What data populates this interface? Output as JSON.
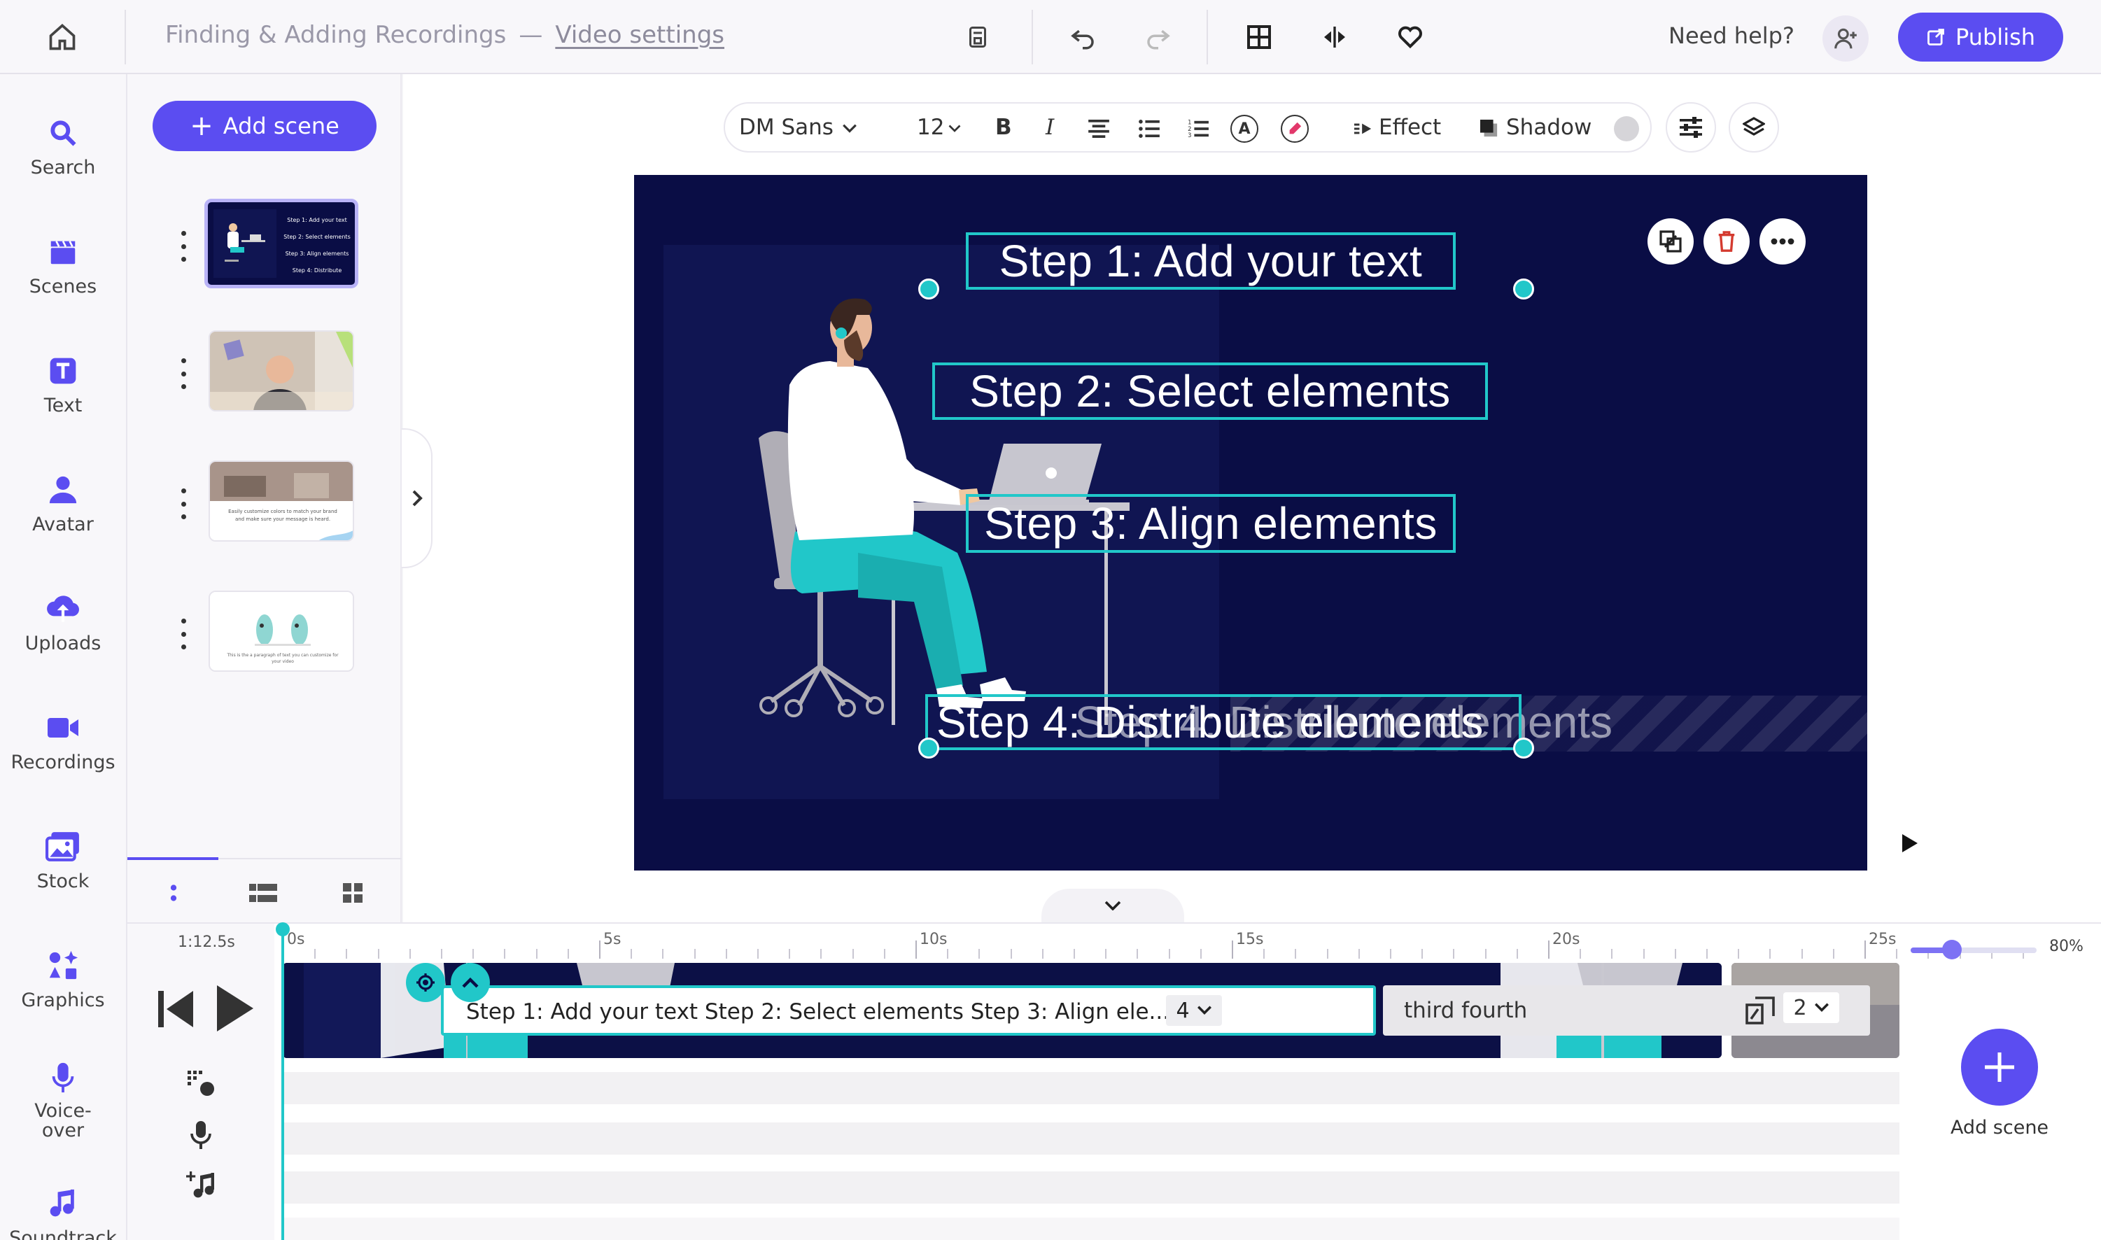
{
  "header": {
    "project_title": "Finding & Adding Recordings",
    "separator": "—",
    "video_settings_link": "Video settings",
    "need_help": "Need help?",
    "publish_label": "Publish"
  },
  "nav": {
    "items": [
      {
        "label": "Search",
        "icon": "search-icon"
      },
      {
        "label": "Scenes",
        "icon": "clapper-icon"
      },
      {
        "label": "Text",
        "icon": "text-icon"
      },
      {
        "label": "Avatar",
        "icon": "avatar-icon"
      },
      {
        "label": "Uploads",
        "icon": "upload-icon"
      },
      {
        "label": "Recordings",
        "icon": "video-camera-icon"
      },
      {
        "label": "Stock",
        "icon": "stock-images-icon"
      },
      {
        "label": "Graphics",
        "icon": "graphics-icon"
      },
      {
        "label": "Voice-over",
        "icon": "microphone-icon"
      },
      {
        "label": "Soundtrack",
        "icon": "music-note-icon"
      }
    ]
  },
  "scenes_panel": {
    "add_scene_label": "Add scene",
    "thumb1_lines": [
      "Step 1: Add your text",
      "Step 2: Select elements",
      "Step 3: Align elements",
      "Step 4: Distribute elements"
    ],
    "thumb3_caption": "Easily customize colors to match your brand and make sure your message is heard.",
    "thumb4_caption": "This is the a paragraph of text you can customize for your video"
  },
  "toolbar": {
    "font_family": "DM Sans",
    "font_size": "12",
    "bold": "B",
    "italic": "I",
    "color_letter": "A",
    "effect_label": "Effect",
    "shadow_label": "Shadow"
  },
  "canvas": {
    "step1": "Step 1: Add your text",
    "step2": "Step 2: Select elements",
    "step3": "Step 3: Align elements",
    "step4": "Step 4: Distribute elements",
    "step4_ghost": "Step 4: Distribute elements"
  },
  "timeline": {
    "duration": "1:12.5s",
    "ruler_labels": [
      "0s",
      "5s",
      "10s",
      "15s",
      "20s",
      "25s"
    ],
    "text_clip_label": "Step 1: Add your text Step 2: Select elements Step 3: Align ele...",
    "text_clip_count": "4",
    "text_clip2_label": "third fourth",
    "text_clip2_count": "2",
    "zoom_label": "80%",
    "zoom_value": 0.33,
    "add_scene_label": "Add scene"
  },
  "colors": {
    "accent": "#5b4df1",
    "teal": "#21c7c9",
    "canvas_bg": "#0a0d45"
  }
}
